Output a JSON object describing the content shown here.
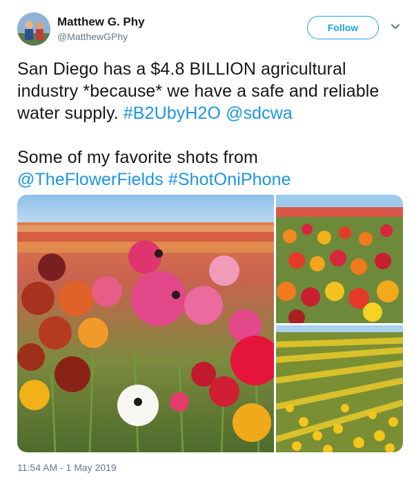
{
  "author": {
    "name": "Matthew G. Phy",
    "handle": "@MatthewGPhy"
  },
  "follow_label": "Follow",
  "tweet": {
    "line1_prefix": "San Diego has a $4.8 BILLION agricultural industry *because* we have a safe and reliable water supply.",
    "hashtag1": "#B2UbyH2O",
    "mention1": "@sdcwa",
    "line2": "Some of my favorite shots from",
    "mention2": "@TheFlowerFields",
    "hashtag2": "#ShotOniPhone"
  },
  "timestamp": "11:54 AM - 1 May 2019",
  "colors": {
    "link": "#1b95e0",
    "follow": "#1da1f2",
    "meta": "#657786"
  },
  "icons": [
    "avatar",
    "chevron-down-icon"
  ]
}
